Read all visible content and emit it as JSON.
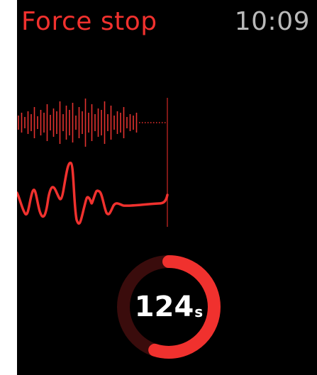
{
  "header": {
    "title": "Force stop",
    "time": "10:09"
  },
  "timer": {
    "value": "124",
    "unit": "s",
    "progress_fraction": 0.55
  },
  "colors": {
    "accent": "#f0312e",
    "ring_track": "#3a0c0c",
    "clock_text": "#b9b9b9"
  }
}
